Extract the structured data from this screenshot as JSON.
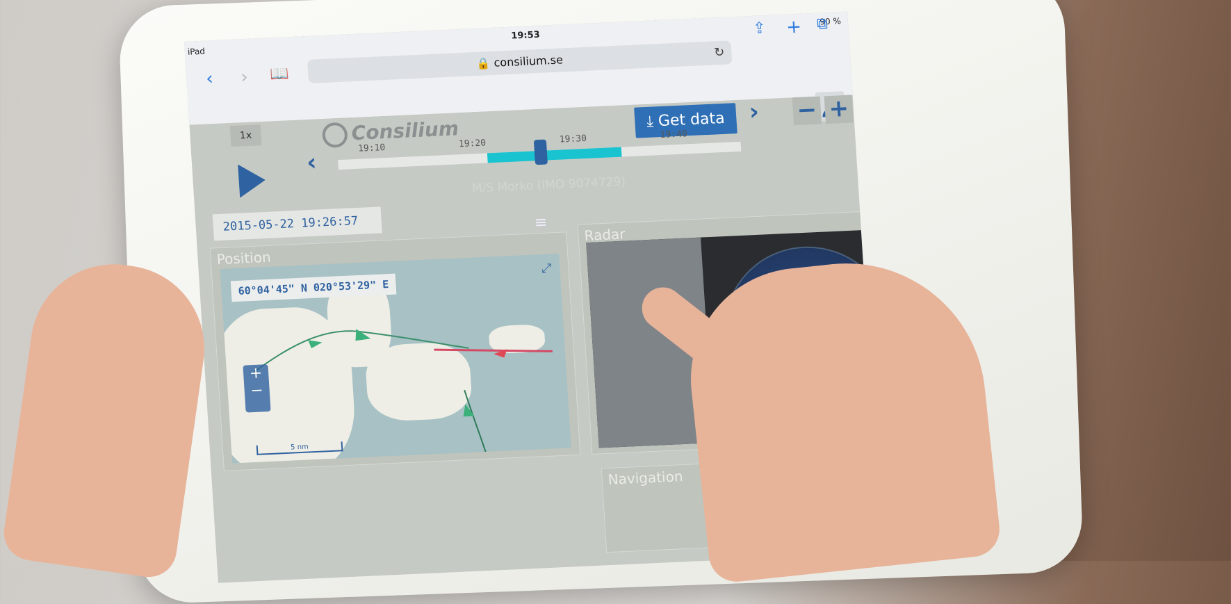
{
  "status_bar": {
    "device": "iPad",
    "time": "19:53",
    "battery": "90 %"
  },
  "browser": {
    "url": "consilium.se"
  },
  "app": {
    "speed": "1x",
    "logo": "Consilium",
    "get_data_label": "Get data",
    "vessel_name": "M/S Morko (IMO 9074729)",
    "datetime": "2015-05-22 19:26:57",
    "timeline": {
      "ticks": [
        "19:10",
        "19:20",
        "19:30",
        "19:40"
      ]
    },
    "zoom": {
      "minus": "−",
      "plus": "+"
    }
  },
  "position_panel": {
    "title": "Position",
    "coordinates": "60°04'45\" N 020°53'29\" E",
    "scale": "5 nm"
  },
  "radar_panel": {
    "title": "Radar"
  },
  "navigation_panel": {
    "title": "Navigation"
  }
}
